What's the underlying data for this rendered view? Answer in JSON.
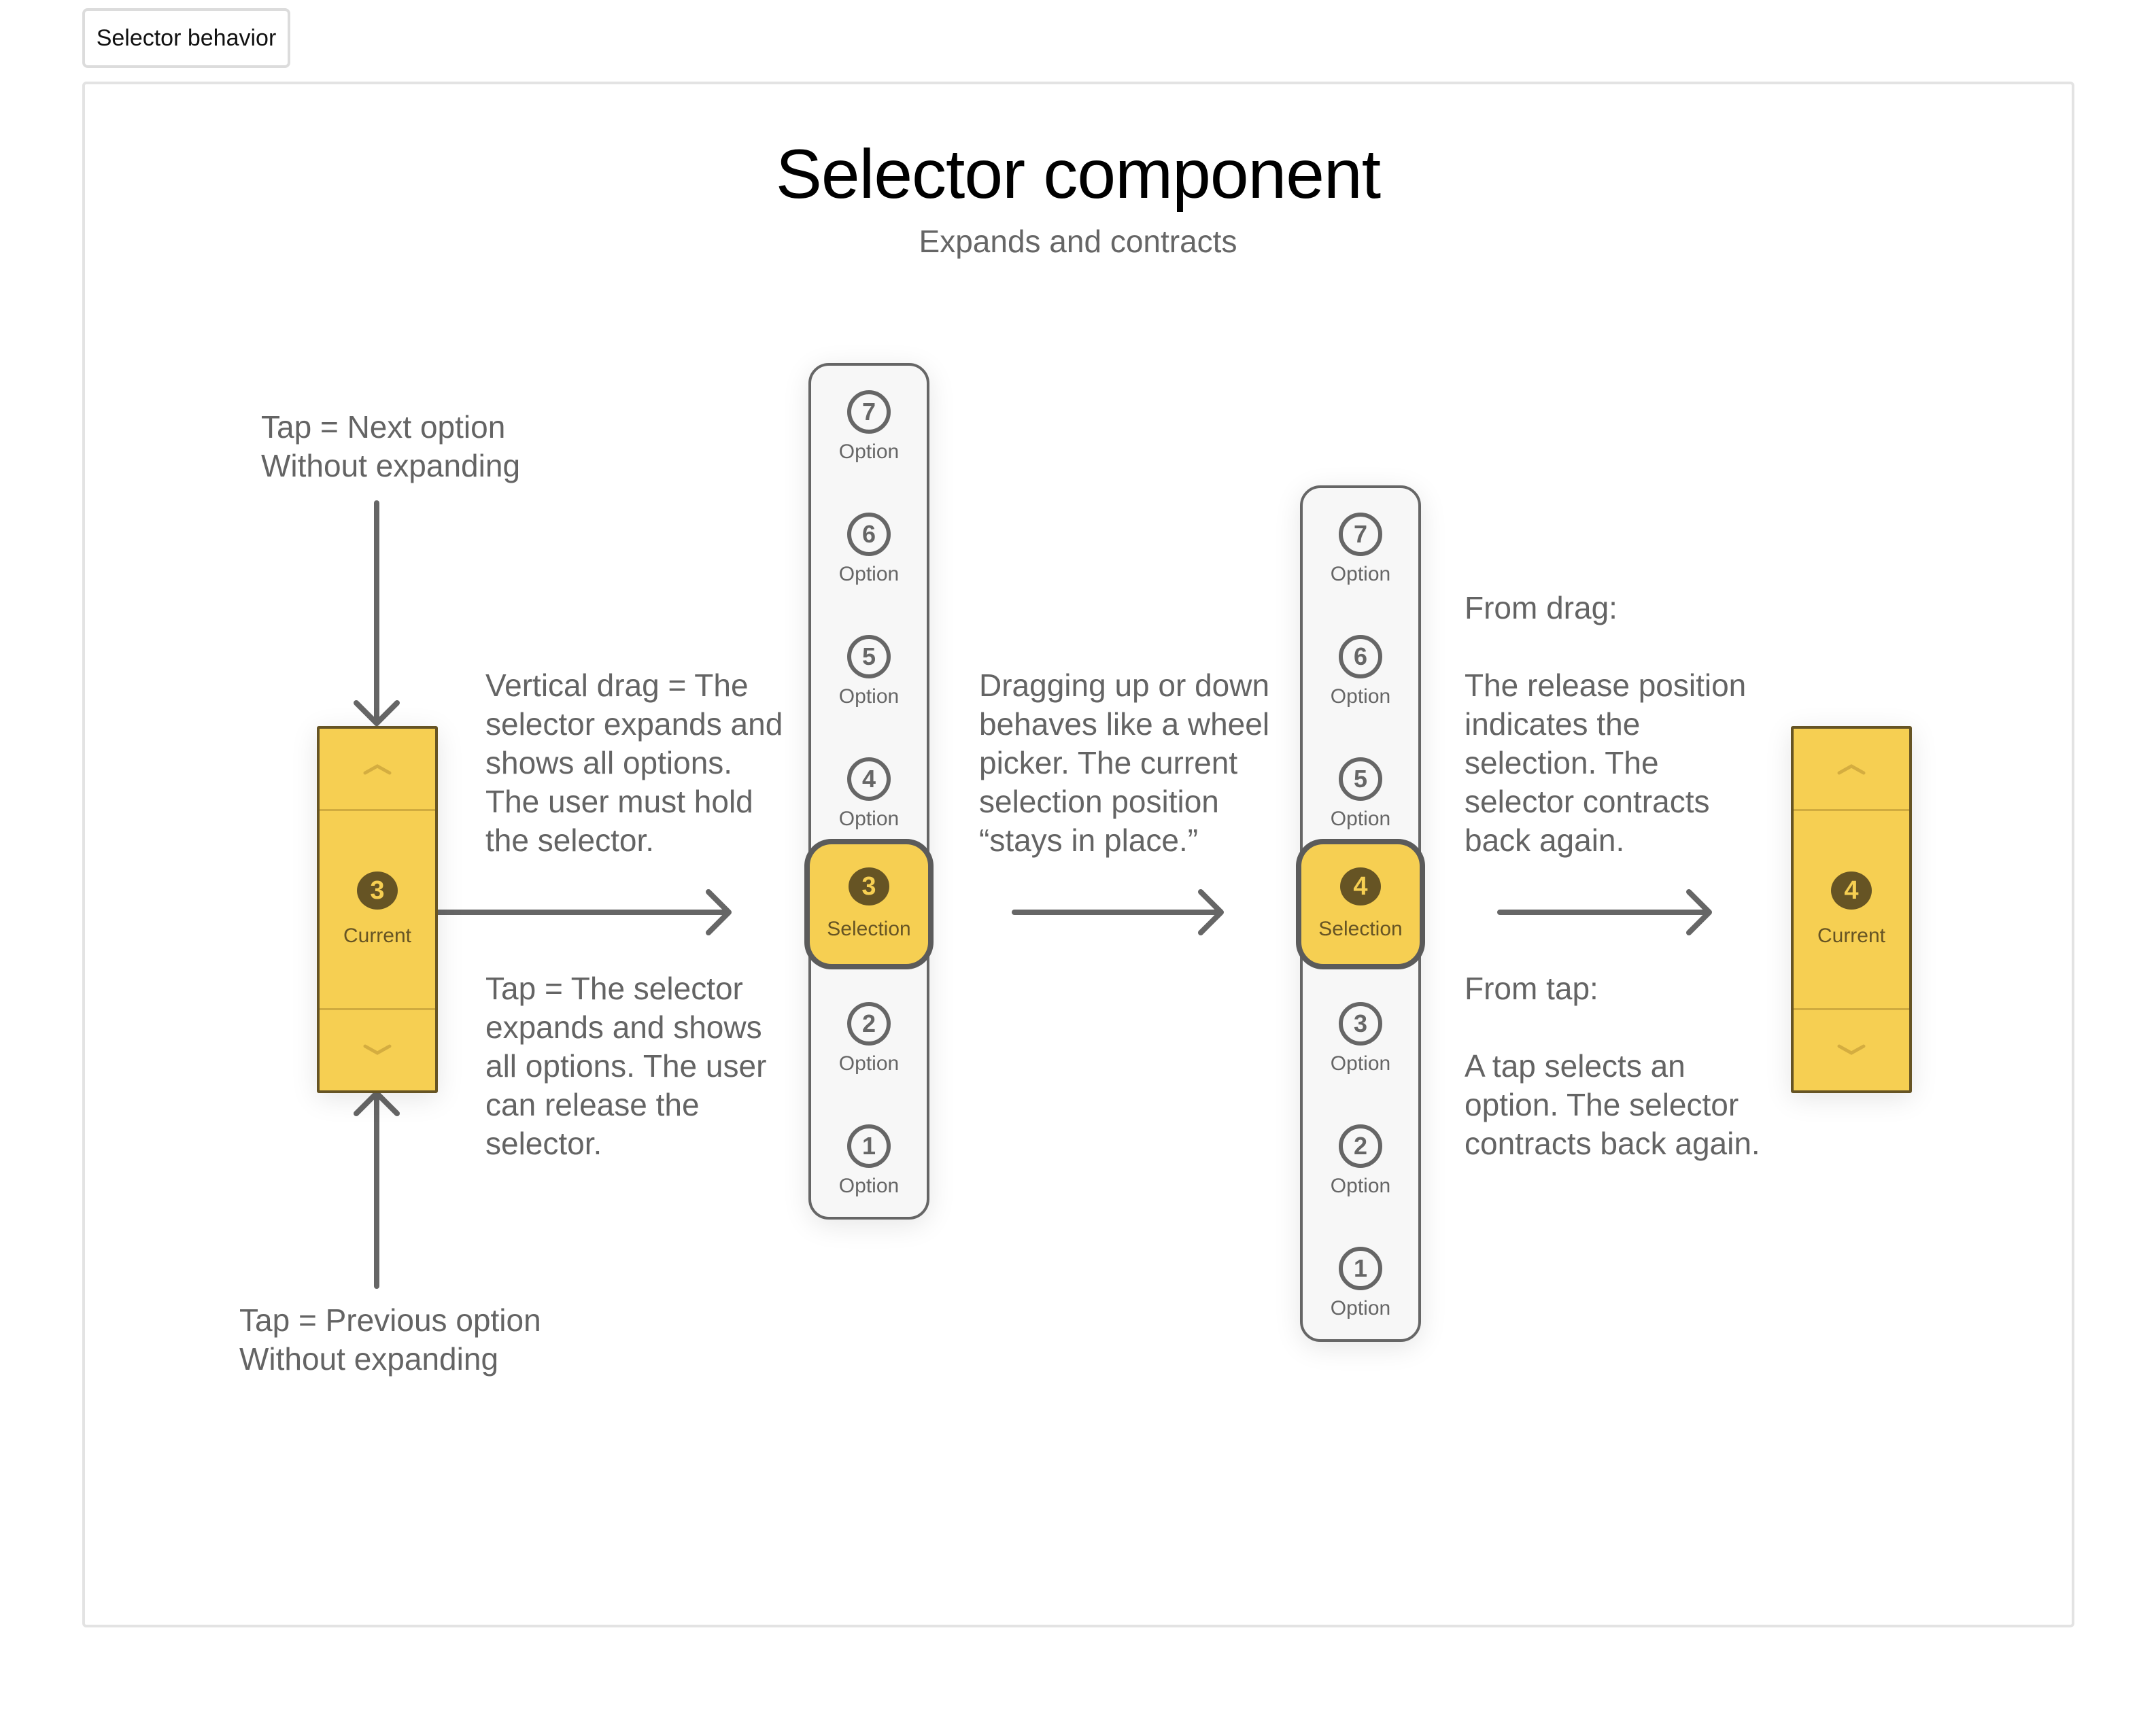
{
  "tab": {
    "label": "Selector behavior"
  },
  "header": {
    "title": "Selector component",
    "subtitle": "Expands and contracts"
  },
  "notes": {
    "tap_next": "Tap = Next option\nWithout expanding",
    "tap_previous": "Tap = Previous option\nWithout expanding",
    "vertical_drag": "Vertical drag = The\nselector expands and\nshows all options.\nThe user must hold\nthe selector.",
    "tap_expand": "Tap = The selector\nexpands and shows\nall options. The user\ncan release the\nselector.",
    "wheel": "Dragging up or down\nbehaves like a wheel\npicker. The current\nselection position\n“stays in place.”",
    "from_drag_heading": "From drag:",
    "from_drag_body": "The release position\nindicates the\nselection. The\nselector contracts\nback again.",
    "from_tap_heading": "From tap:",
    "from_tap_body": "A tap selects an\noption. The selector\ncontracts back again."
  },
  "colors": {
    "accent": "#f6cf52",
    "accent_dark": "#665424",
    "ink": "#666666"
  },
  "selector_before": {
    "value": "3",
    "label": "Current",
    "up_icon": "chevron-up",
    "down_icon": "chevron-down"
  },
  "selector_after": {
    "value": "4",
    "label": "Current",
    "up_icon": "chevron-up",
    "down_icon": "chevron-down"
  },
  "picker_1": {
    "items": [
      {
        "value": "7",
        "label": "Option"
      },
      {
        "value": "6",
        "label": "Option"
      },
      {
        "value": "5",
        "label": "Option"
      },
      {
        "value": "4",
        "label": "Option"
      },
      {
        "value": "3",
        "label": "Selection",
        "selected": true
      },
      {
        "value": "2",
        "label": "Option"
      },
      {
        "value": "1",
        "label": "Option"
      }
    ]
  },
  "picker_2": {
    "items": [
      {
        "value": "7",
        "label": "Option"
      },
      {
        "value": "6",
        "label": "Option"
      },
      {
        "value": "5",
        "label": "Option"
      },
      {
        "value": "4",
        "label": "Selection",
        "selected": true
      },
      {
        "value": "3",
        "label": "Option"
      },
      {
        "value": "2",
        "label": "Option"
      },
      {
        "value": "1",
        "label": "Option"
      }
    ]
  }
}
